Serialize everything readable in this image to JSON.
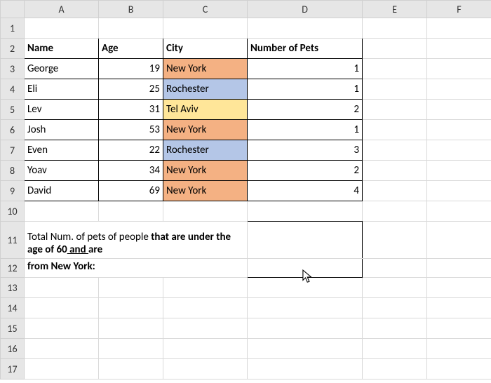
{
  "columns": [
    "A",
    "B",
    "C",
    "D",
    "E",
    "F"
  ],
  "rowCount": 17,
  "headers": {
    "name": "Name",
    "age": "Age",
    "city": "City",
    "pets": "Number of Pets"
  },
  "rows": [
    {
      "name": "George",
      "age": 19,
      "city": "New York",
      "pets": 1,
      "cityColor": "orange"
    },
    {
      "name": "Eli",
      "age": 25,
      "city": "Rochester",
      "pets": 1,
      "cityColor": "blue"
    },
    {
      "name": "Lev",
      "age": 31,
      "city": "Tel Aviv",
      "pets": 2,
      "cityColor": "yellow"
    },
    {
      "name": "Josh",
      "age": 53,
      "city": "New York",
      "pets": 1,
      "cityColor": "orange"
    },
    {
      "name": "Even",
      "age": 22,
      "city": "Rochester",
      "pets": 3,
      "cityColor": "blue"
    },
    {
      "name": "Yoav",
      "age": 34,
      "city": "New York",
      "pets": 2,
      "cityColor": "orange"
    },
    {
      "name": "David",
      "age": 69,
      "city": "New York",
      "pets": 4,
      "cityColor": "orange"
    }
  ],
  "footer": {
    "pre": "Total Num. of pets of people ",
    "bold1": "that are under the age of 60",
    "and": " and ",
    "bold2": "are from New York:"
  },
  "chart_data": {
    "type": "table",
    "columns": [
      "Name",
      "Age",
      "City",
      "Number of Pets"
    ],
    "rows": [
      [
        "George",
        19,
        "New York",
        1
      ],
      [
        "Eli",
        25,
        "Rochester",
        1
      ],
      [
        "Lev",
        31,
        "Tel Aviv",
        2
      ],
      [
        "Josh",
        53,
        "New York",
        1
      ],
      [
        "Even",
        22,
        "Rochester",
        3
      ],
      [
        "Yoav",
        34,
        "New York",
        2
      ],
      [
        "David",
        69,
        "New York",
        4
      ]
    ],
    "question": "Total Num. of pets of people that are under the age of 60 and are from New York:"
  }
}
